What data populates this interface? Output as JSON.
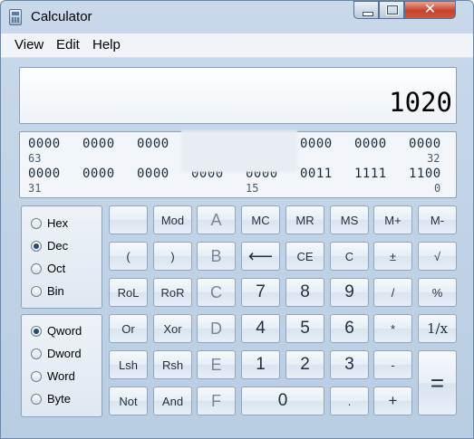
{
  "window": {
    "title": "Calculator",
    "min_icon": "minimize-icon",
    "max_icon": "maximize-icon",
    "close_icon": "close-icon"
  },
  "menu": [
    "View",
    "Edit",
    "Help"
  ],
  "display": {
    "value": "1020"
  },
  "bits": {
    "row1": [
      "0000",
      "0000",
      "0000",
      "0000",
      "0000",
      "0000"
    ],
    "row1_pos_left": "63",
    "row1_pos_right": "32",
    "row2": [
      "0000",
      "0000",
      "0000",
      "0000",
      "0000",
      "0011",
      "1111",
      "1100"
    ],
    "row2_pos_left": "31",
    "row2_pos_mid": "15",
    "row2_pos_right": "0"
  },
  "radix": {
    "options": [
      "Hex",
      "Dec",
      "Oct",
      "Bin"
    ],
    "selected": "Dec"
  },
  "wordsize": {
    "options": [
      "Qword",
      "Dword",
      "Word",
      "Byte"
    ],
    "selected": "Qword"
  },
  "keys": {
    "r1": [
      "",
      "Mod",
      "A",
      "MC",
      "MR",
      "MS",
      "M+",
      "M-"
    ],
    "r2": [
      "(",
      ")",
      "B",
      "⟵",
      "CE",
      "C",
      "±",
      "√"
    ],
    "r3": [
      "RoL",
      "RoR",
      "C",
      "7",
      "8",
      "9",
      "/",
      "%"
    ],
    "r4": [
      "Or",
      "Xor",
      "D",
      "4",
      "5",
      "6",
      "*",
      "1/x"
    ],
    "r5": [
      "Lsh",
      "Rsh",
      "E",
      "1",
      "2",
      "3",
      "-",
      "="
    ],
    "r6": [
      "Not",
      "And",
      "F",
      "0",
      ".",
      "+"
    ]
  }
}
